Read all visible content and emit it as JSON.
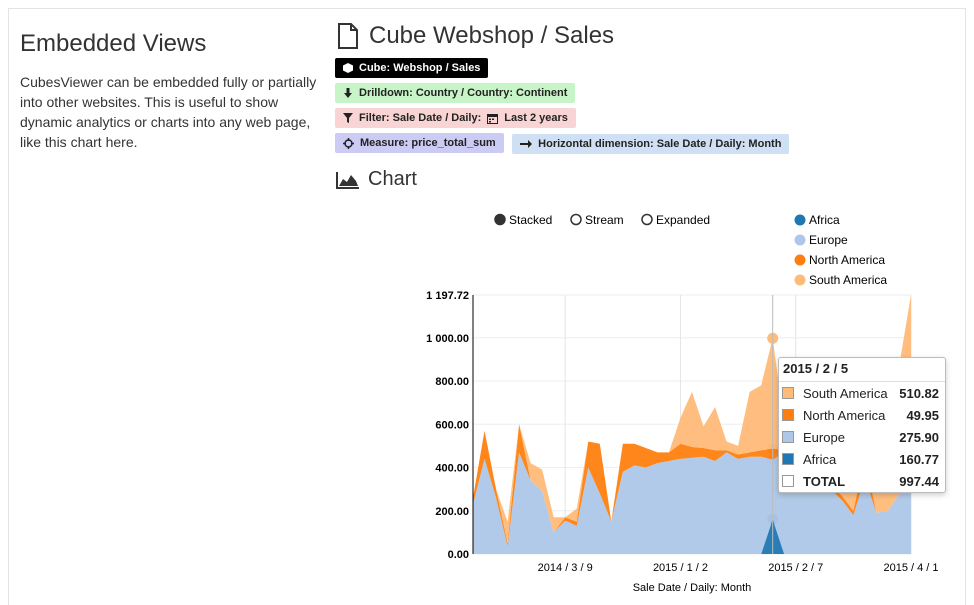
{
  "intro": {
    "title": "Embedded Views",
    "text": "CubesViewer can be embedded fully or partially into other websites. This is useful to show dynamic analytics or charts into any web page, like this chart here."
  },
  "view": {
    "title": "Cube Webshop / Sales",
    "tags": [
      {
        "kind": "cube",
        "label": "Cube: Webshop / Sales",
        "icon": "cube-icon"
      },
      {
        "kind": "drill",
        "label": "Drilldown: Country / Country: Continent",
        "icon": "arrow-down-icon"
      },
      {
        "kind": "filter",
        "label": "Filter: Sale Date / Daily: ",
        "extra": "Last 2 years",
        "icon": "filter-icon"
      },
      {
        "kind": "measure",
        "label": "Measure: price_total_sum",
        "icon": "crosshair-icon"
      },
      {
        "kind": "hdim",
        "label": "Horizontal dimension: Sale Date / Daily: Month",
        "icon": "arrow-right-icon"
      }
    ]
  },
  "chart_section": {
    "title": "Chart"
  },
  "controls": {
    "modes": [
      {
        "label": "Stacked",
        "selected": true
      },
      {
        "label": "Stream",
        "selected": false
      },
      {
        "label": "Expanded",
        "selected": false
      }
    ]
  },
  "chart_data": {
    "type": "area",
    "stacked": true,
    "xlabel": "Sale Date / Daily: Month",
    "ylabel": "",
    "ylim": [
      0,
      1197.72
    ],
    "yticks": [
      "0.00",
      "200.00",
      "400.00",
      "600.00",
      "800.00",
      "1 000.00",
      "1 197.72"
    ],
    "yticks_values": [
      0,
      200,
      400,
      600,
      800,
      1000,
      1197.72
    ],
    "xtick_labels": [
      {
        "index": 8,
        "label": "2014 / 3 / 9"
      },
      {
        "index": 18,
        "label": "2015 / 1 / 2"
      },
      {
        "index": 28,
        "label": "2015 / 2 / 7"
      },
      {
        "index": 38,
        "label": "2015 / 4 / 1"
      }
    ],
    "legend_position": "top-right",
    "colors": {
      "Africa": "#1f77b4",
      "Europe": "#aec7e8",
      "North America": "#ff7f0e",
      "South America": "#ffbb78"
    },
    "series": [
      {
        "name": "Africa",
        "values": [
          0,
          0,
          0,
          0,
          0,
          0,
          0,
          0,
          0,
          0,
          0,
          0,
          0,
          0,
          0,
          0,
          0,
          0,
          0,
          0,
          0,
          0,
          0,
          0,
          0,
          0,
          160.77,
          0,
          0,
          0,
          0,
          0,
          0,
          0,
          0,
          0,
          0,
          0,
          0
        ]
      },
      {
        "name": "Europe",
        "values": [
          230,
          440,
          260,
          35,
          470,
          340,
          290,
          100,
          155,
          130,
          400,
          280,
          150,
          380,
          410,
          400,
          420,
          430,
          440,
          445,
          450,
          430,
          470,
          440,
          450,
          450,
          275.9,
          470,
          430,
          300,
          420,
          300,
          250,
          180,
          350,
          190,
          200,
          280,
          560
        ]
      },
      {
        "name": "North America",
        "values": [
          30,
          130,
          40,
          15,
          130,
          0,
          0,
          0,
          15,
          20,
          120,
          230,
          0,
          130,
          100,
          90,
          50,
          40,
          70,
          50,
          40,
          50,
          10,
          20,
          20,
          30,
          49.95,
          10,
          20,
          30,
          30,
          20,
          20,
          20,
          100,
          0,
          0,
          0,
          0
        ]
      },
      {
        "name": "South America",
        "values": [
          0,
          0,
          0,
          100,
          0,
          80,
          100,
          70,
          0,
          60,
          0,
          0,
          0,
          0,
          0,
          0,
          0,
          0,
          120,
          255,
          100,
          200,
          40,
          40,
          280,
          300,
          510.82,
          120,
          90,
          240,
          120,
          190,
          290,
          130,
          40,
          240,
          420,
          600,
          637.72
        ]
      }
    ],
    "tooltip": {
      "title": "2015 / 2 / 5",
      "index": 26,
      "rows": [
        {
          "name": "South America",
          "value": "510.82"
        },
        {
          "name": "North America",
          "value": "49.95"
        },
        {
          "name": "Europe",
          "value": "275.90"
        },
        {
          "name": "Africa",
          "value": "160.77"
        }
      ],
      "total_label": "TOTAL",
      "total_value": "997.44"
    }
  }
}
